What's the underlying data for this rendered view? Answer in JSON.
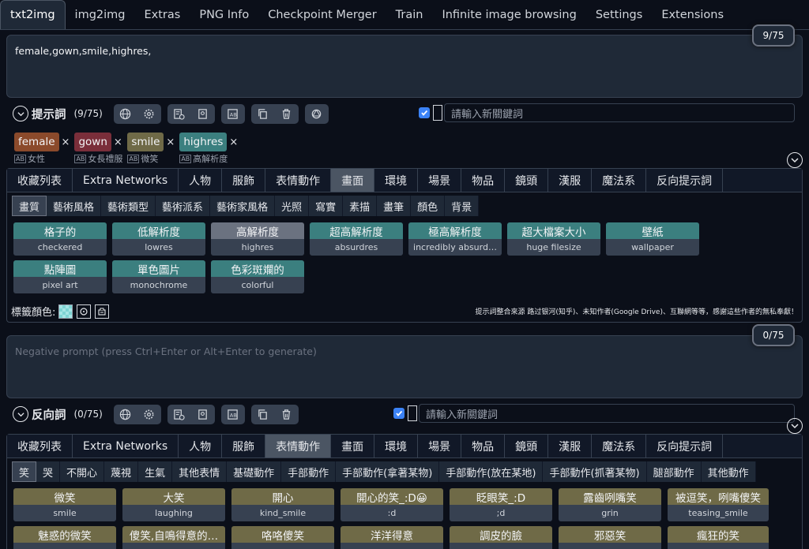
{
  "top_tabs": [
    "txt2img",
    "img2img",
    "Extras",
    "PNG Info",
    "Checkpoint Merger",
    "Train",
    "Infinite image browsing",
    "Settings",
    "Extensions"
  ],
  "positive": {
    "text": "female,gown,smile,highres,",
    "counter": "9/75",
    "title": "提示詞",
    "count": "(9/75)",
    "kw_placeholder": "請輸入新關鍵詞",
    "tags": [
      {
        "label": "female",
        "sub": "女性"
      },
      {
        "label": "gown",
        "sub": "女長禮服"
      },
      {
        "label": "smile",
        "sub": "微笑"
      },
      {
        "label": "highres",
        "sub": "高解析度"
      }
    ],
    "tag_close": "×",
    "categories": [
      "收藏列表",
      "Extra Networks",
      "人物",
      "服飾",
      "表情動作",
      "畫面",
      "環境",
      "場景",
      "物品",
      "鏡頭",
      "漢服",
      "魔法系",
      "反向提示詞"
    ],
    "subcategories": [
      "畫質",
      "藝術風格",
      "藝術類型",
      "藝術派系",
      "藝術家風格",
      "光照",
      "寫實",
      "素描",
      "畫筆",
      "顏色",
      "背景"
    ],
    "buttons": [
      {
        "zh": "格子的",
        "en": "checkered"
      },
      {
        "zh": "低解析度",
        "en": "lowres"
      },
      {
        "zh": "高解析度",
        "en": "highres"
      },
      {
        "zh": "超高解析度",
        "en": "absurdres"
      },
      {
        "zh": "極高解析度",
        "en": "incredibly absurd…"
      },
      {
        "zh": "超大檔案大小",
        "en": "huge filesize"
      },
      {
        "zh": "壁紙",
        "en": "wallpaper"
      },
      {
        "zh": "點陣圖",
        "en": "pixel art"
      },
      {
        "zh": "單色圖片",
        "en": "monochrome"
      },
      {
        "zh": "色彩斑斕的",
        "en": "colorful"
      }
    ],
    "tag_color_label": "標籤顏色:",
    "credits": "提示詞整合來源 路过银河(知乎)、未知作者(Google Drive)、互聯網等等，感謝這些作者的無私奉獻！"
  },
  "negative": {
    "placeholder": "Negative prompt (press Ctrl+Enter or Alt+Enter to generate)",
    "counter": "0/75",
    "title": "反向詞",
    "count": "(0/75)",
    "kw_placeholder": "請輸入新關鍵詞",
    "categories": [
      "收藏列表",
      "Extra Networks",
      "人物",
      "服飾",
      "表情動作",
      "畫面",
      "環境",
      "場景",
      "物品",
      "鏡頭",
      "漢服",
      "魔法系",
      "反向提示詞"
    ],
    "subcategories": [
      "笑",
      "哭",
      "不開心",
      "蔑視",
      "生氣",
      "其他表情",
      "基礎動作",
      "手部動作",
      "手部動作(拿著某物)",
      "手部動作(放在某地)",
      "手部動作(抓著某物)",
      "腿部動作",
      "其他動作"
    ],
    "buttons": [
      {
        "zh": "微笑",
        "en": "smile"
      },
      {
        "zh": "大笑",
        "en": "laughing"
      },
      {
        "zh": "開心",
        "en": "kind_smile"
      },
      {
        "zh": "開心的笑_:D😀",
        "en": ":d"
      },
      {
        "zh": "眨眼笑_:D",
        "en": ";d"
      },
      {
        "zh": "露齒咧嘴笑",
        "en": "grin"
      },
      {
        "zh": "被逗笑，咧嘴傻笑",
        "en": "teasing_smile"
      },
      {
        "zh": "魅惑的微笑",
        "en": ""
      },
      {
        "zh": "傻笑,自鳴得意的…",
        "en": ""
      },
      {
        "zh": "咯咯傻笑",
        "en": ""
      },
      {
        "zh": "洋洋得意",
        "en": ""
      },
      {
        "zh": "調皮的臉",
        "en": ""
      },
      {
        "zh": "邪惡笑",
        "en": ""
      },
      {
        "zh": "瘋狂的笑",
        "en": ""
      }
    ]
  },
  "colors": {
    "teal": "#3b7f7f",
    "olive": "#6f6a47",
    "selected": "#6b7280"
  }
}
